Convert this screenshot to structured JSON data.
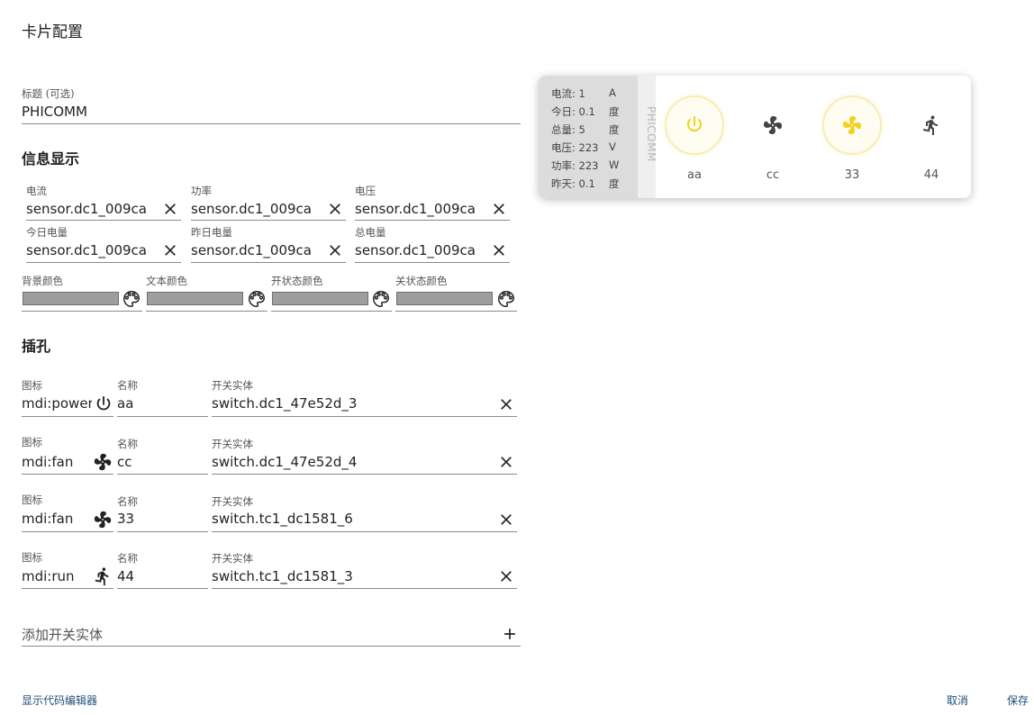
{
  "dialog": {
    "title": "卡片配置",
    "footer": {
      "code_editor": "显示代码编辑器",
      "cancel": "取消",
      "save": "保存"
    }
  },
  "title_field": {
    "label": "标题 (可选)",
    "value": "PHICOMM"
  },
  "info_section": {
    "heading": "信息显示",
    "fields": [
      {
        "label": "电流",
        "value": "sensor.dc1_009ca"
      },
      {
        "label": "功率",
        "value": "sensor.dc1_009ca"
      },
      {
        "label": "电压",
        "value": "sensor.dc1_009ca"
      },
      {
        "label": "今日电量",
        "value": "sensor.dc1_009ca"
      },
      {
        "label": "昨日电量",
        "value": "sensor.dc1_009ca"
      },
      {
        "label": "总电量",
        "value": "sensor.dc1_009ca"
      }
    ],
    "colors": [
      {
        "label": "背景颜色",
        "value": "#9e9e9e"
      },
      {
        "label": "文本颜色",
        "value": "#9e9e9e"
      },
      {
        "label": "开状态颜色",
        "value": "#9e9e9e"
      },
      {
        "label": "关状态颜色",
        "value": "#9e9e9e"
      }
    ]
  },
  "sockets_section": {
    "heading": "插孔",
    "icon_label": "图标",
    "name_label": "名称",
    "entity_label": "开关实体",
    "rows": [
      {
        "icon": "mdi:power",
        "icon_name": "power-icon",
        "name": "aa",
        "entity": "switch.dc1_47e52d_3"
      },
      {
        "icon": "mdi:fan",
        "icon_name": "fan-icon",
        "name": "cc",
        "entity": "switch.dc1_47e52d_4"
      },
      {
        "icon": "mdi:fan",
        "icon_name": "fan-icon",
        "name": "33",
        "entity": "switch.tc1_dc1581_6"
      },
      {
        "icon": "mdi:run",
        "icon_name": "run-icon",
        "name": "44",
        "entity": "switch.tc1_dc1581_3"
      }
    ],
    "add_label": "添加开关实体"
  },
  "preview": {
    "title": "PHICOMM",
    "info": [
      {
        "label": "电流: 1",
        "unit": "A"
      },
      {
        "label": "今日: 0.1",
        "unit": "度"
      },
      {
        "label": "总量: 5",
        "unit": "度"
      },
      {
        "label": "电压: 223",
        "unit": "V"
      },
      {
        "label": "功率: 223",
        "unit": "W"
      },
      {
        "label": "昨天: 0.1",
        "unit": "度"
      }
    ],
    "sockets": [
      {
        "name": "aa",
        "icon": "power-icon",
        "state": "on",
        "color": "#f0d21a"
      },
      {
        "name": "cc",
        "icon": "fan-icon",
        "state": "off",
        "color": "#444444"
      },
      {
        "name": "33",
        "icon": "fan-icon",
        "state": "on",
        "color": "#f0d21a"
      },
      {
        "name": "44",
        "icon": "run-icon",
        "state": "off",
        "color": "#444444"
      }
    ]
  }
}
